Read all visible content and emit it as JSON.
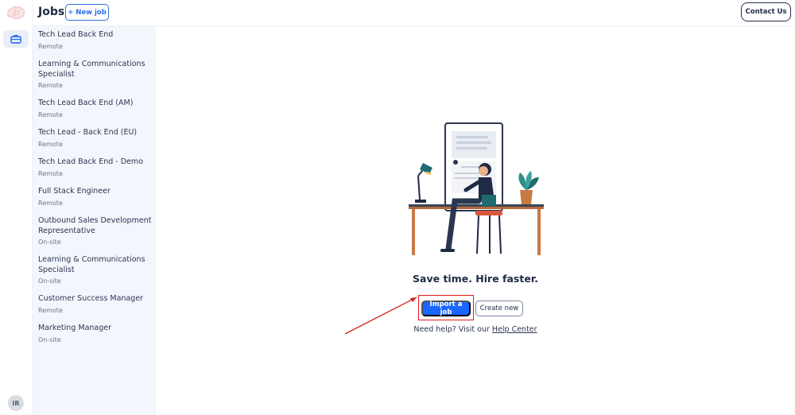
{
  "app": {
    "title": "Jobs",
    "new_job_label": "+ New job",
    "contact_label": "Contact Us",
    "user_initials": "IR"
  },
  "colors": {
    "accent": "#1a66ff",
    "sidebar_bg": "#f3f6fc",
    "highlight_box": "#e01b1b"
  },
  "rail": {
    "items": [
      {
        "icon": "briefcase-icon",
        "active": true
      }
    ]
  },
  "jobs": [
    {
      "title": "Tech Lead Back End",
      "location": "Remote"
    },
    {
      "title": "Learning & Communications Specialist",
      "location": "Remote"
    },
    {
      "title": "Tech Lead Back End (AM)",
      "location": "Remote"
    },
    {
      "title": "Tech Lead - Back End (EU)",
      "location": "Remote"
    },
    {
      "title": "Tech Lead Back End - Demo",
      "location": "Remote"
    },
    {
      "title": "Full Stack Engineer",
      "location": "Remote"
    },
    {
      "title": "Outbound Sales Development Representative",
      "location": "On-site"
    },
    {
      "title": "Learning & Communications Specialist",
      "location": "On-site"
    },
    {
      "title": "Customer Success Manager",
      "location": "Remote"
    },
    {
      "title": "Marketing Manager",
      "location": "On-site"
    }
  ],
  "empty_state": {
    "tagline": "Save time. Hire faster.",
    "import_label": "Import a job",
    "create_label": "Create new",
    "help_prefix": "Need help? Visit our",
    "help_link": "Help Center"
  }
}
